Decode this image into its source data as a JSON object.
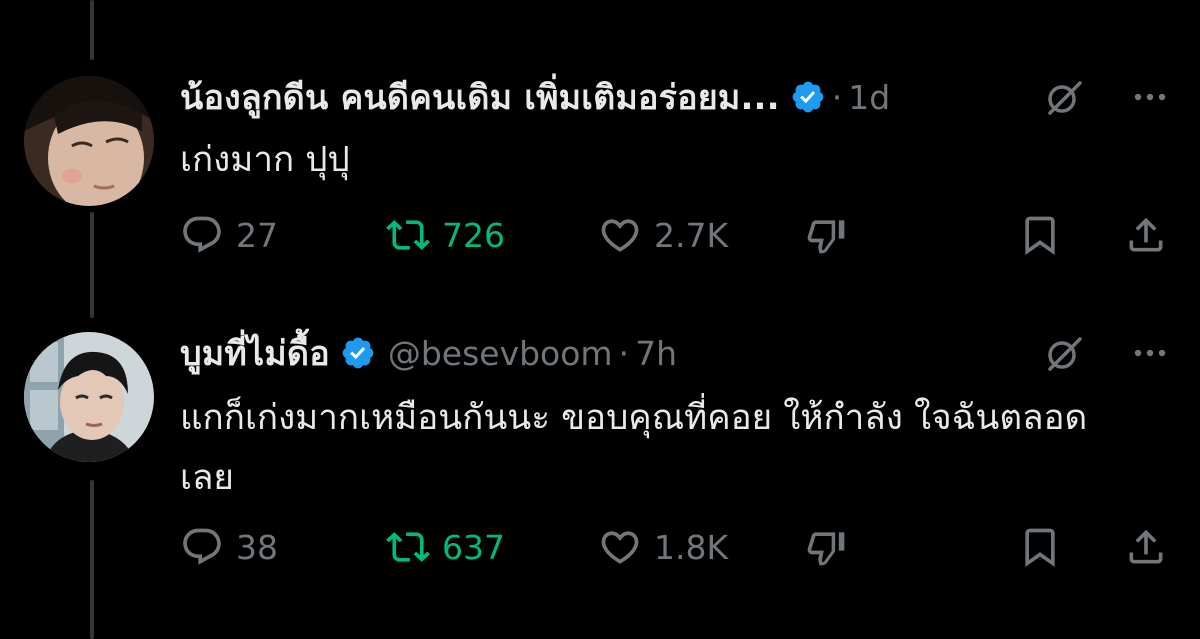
{
  "tweets": [
    {
      "name": "น้องลูกดีน คนดีคนเดิม เพิ่มเติมอร่อยม...",
      "handle": "",
      "dot": "·",
      "time": "1d",
      "text": "เก่งมาก ปุปุ",
      "replies": "27",
      "retweets": "726",
      "likes": "2.7K"
    },
    {
      "name": "บูมที่ไม่ดื้อ",
      "handle": "@besevboom",
      "dot": "·",
      "time": "7h",
      "text": "แกก็เก่งมากเหมือนกันนะ ขอบคุณที่คอย ให้กำลัง ใจฉันตลอดเลย",
      "replies": "38",
      "retweets": "637",
      "likes": "1.8K"
    }
  ],
  "icons": {
    "verified": "verified-badge-icon",
    "grok": "grok-icon",
    "more": "more-icon",
    "reply": "reply-icon",
    "retweet": "retweet-icon",
    "like": "heart-icon",
    "dislike": "downvote-icon",
    "bookmark": "bookmark-icon",
    "share": "share-icon"
  },
  "colors": {
    "background": "#000000",
    "text": "#e7e9ea",
    "muted": "#71767b",
    "retweet": "#00ba7c",
    "verified": "#1d9bf0"
  }
}
